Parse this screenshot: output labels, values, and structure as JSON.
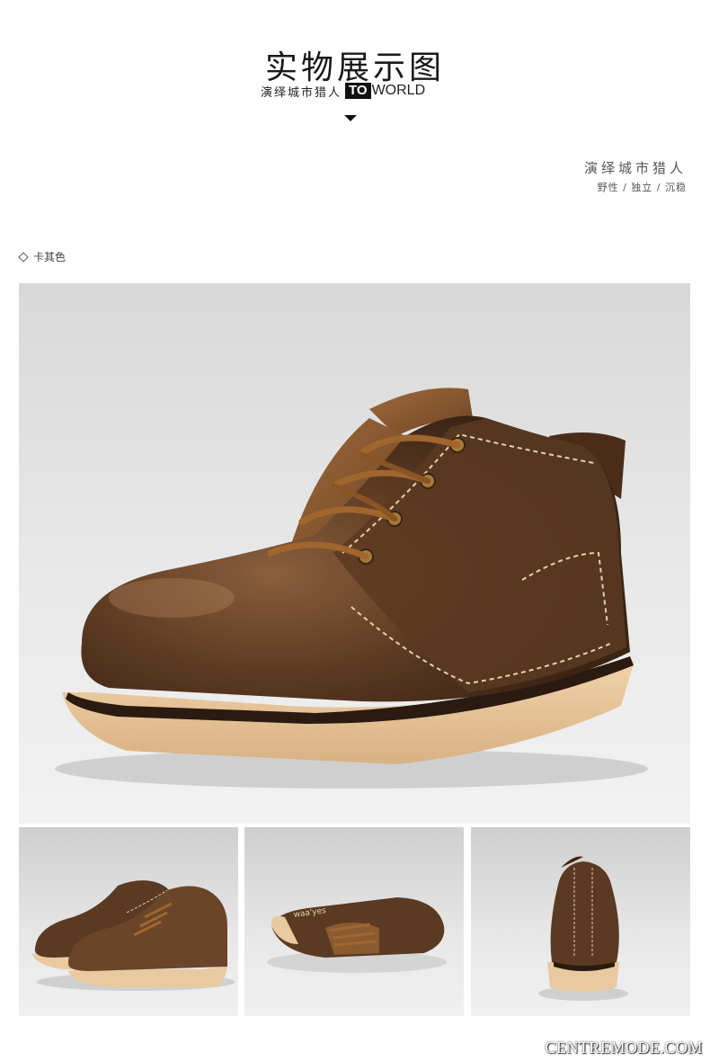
{
  "header": {
    "title": "实物展示图",
    "subtitle_cn": "演绎城市猎人",
    "subtitle_to": "TO",
    "subtitle_world": "WORLD"
  },
  "side": {
    "title": "演绎城市猎人",
    "tags": "野性 / 独立 / 沉稳"
  },
  "color_label": "卡其色",
  "thumbs": [
    {
      "name": "pair-front-view"
    },
    {
      "name": "side-view"
    },
    {
      "name": "back-view"
    }
  ],
  "watermark": "CENTREMODE.COM",
  "colors": {
    "leather": "#5a3a22",
    "sole": "#e8c9a0",
    "lace": "#a0662e",
    "background": "#e4e4e4"
  }
}
